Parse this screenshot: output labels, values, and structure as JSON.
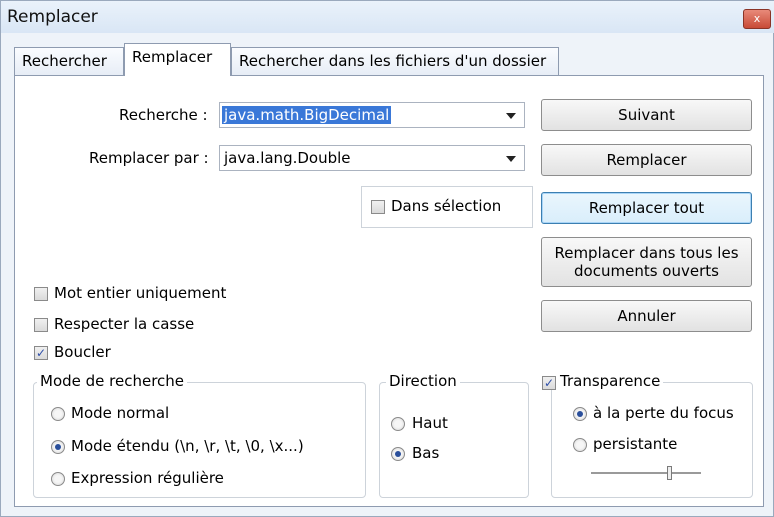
{
  "window": {
    "title": "Remplacer",
    "close_glyph": "x"
  },
  "tabs": [
    {
      "label": "Rechercher"
    },
    {
      "label": "Remplacer"
    },
    {
      "label": "Rechercher dans les fichiers d'un dossier"
    }
  ],
  "search": {
    "label": "Recherche :",
    "value": "java.math.BigDecimal"
  },
  "replace": {
    "label": "Remplacer par :",
    "value": "java.lang.Double"
  },
  "buttons": {
    "next": "Suivant",
    "replace": "Remplacer",
    "replace_all": "Remplacer tout",
    "replace_all_docs_line1": "Remplacer dans tous les",
    "replace_all_docs_line2": "documents ouverts",
    "cancel": "Annuler"
  },
  "options": {
    "in_selection": {
      "label": "Dans sélection",
      "checked": false
    },
    "whole_word": {
      "label": "Mot entier uniquement",
      "checked": false
    },
    "match_case": {
      "label": "Respecter la casse",
      "checked": false
    },
    "wrap": {
      "label": "Boucler",
      "checked": true,
      "mark": "✓"
    }
  },
  "search_mode": {
    "legend": "Mode de recherche",
    "options": [
      {
        "label": "Mode normal",
        "selected": false
      },
      {
        "label": "Mode étendu (\\n, \\r, \\t, \\0, \\x...)",
        "selected": true
      },
      {
        "label": "Expression régulière",
        "selected": false
      }
    ]
  },
  "direction": {
    "legend": "Direction",
    "options": [
      {
        "label": "Haut",
        "selected": false
      },
      {
        "label": "Bas",
        "selected": true
      }
    ]
  },
  "transparency": {
    "label": "Transparence",
    "checked": true,
    "mark": "✓",
    "options": [
      {
        "label": "à la perte du focus",
        "selected": true
      },
      {
        "label": "persistante",
        "selected": false
      }
    ],
    "slider_level": 0.72
  }
}
